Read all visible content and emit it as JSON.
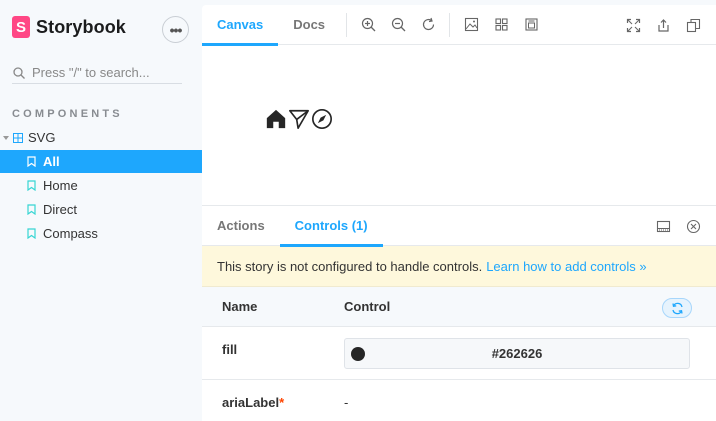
{
  "sidebar": {
    "brand": "Storybook",
    "brand_logo_letter": "S",
    "menu_icon": "ellipsis-icon",
    "search_placeholder": "Press \"/\" to search...",
    "section_title": "COMPONENTS",
    "group": "SVG",
    "stories": [
      {
        "label": "All",
        "selected": true
      },
      {
        "label": "Home",
        "selected": false
      },
      {
        "label": "Direct",
        "selected": false
      },
      {
        "label": "Compass",
        "selected": false
      }
    ]
  },
  "toolbar": {
    "tabs": [
      {
        "label": "Canvas",
        "active": true
      },
      {
        "label": "Docs",
        "active": false
      }
    ],
    "tools": [
      "zoom-in-icon",
      "zoom-out-icon",
      "zoom-reset-icon",
      "background-icon",
      "grid-icon",
      "outline-icon"
    ],
    "right_tools": [
      "fullscreen-icon",
      "share-icon",
      "copy-link-icon"
    ]
  },
  "preview": {
    "icons": [
      "home-icon",
      "direct-icon",
      "compass-icon"
    ]
  },
  "addons": {
    "tabs": [
      {
        "label": "Actions",
        "active": false
      },
      {
        "label": "Controls (1)",
        "active": true
      }
    ],
    "notice_text": "This story is not configured to handle controls.",
    "notice_link": "Learn how to add controls »",
    "columns": {
      "name": "Name",
      "control": "Control"
    },
    "rows": [
      {
        "name": "fill",
        "value": "#262626",
        "required": false
      },
      {
        "name": "ariaLabel",
        "value": "-",
        "required": true,
        "required_mark": "*"
      }
    ]
  },
  "colors": {
    "accent": "#1ea7fd",
    "brand": "#ff4785",
    "swatch": "#262626",
    "notice_bg": "#fef8dc"
  }
}
